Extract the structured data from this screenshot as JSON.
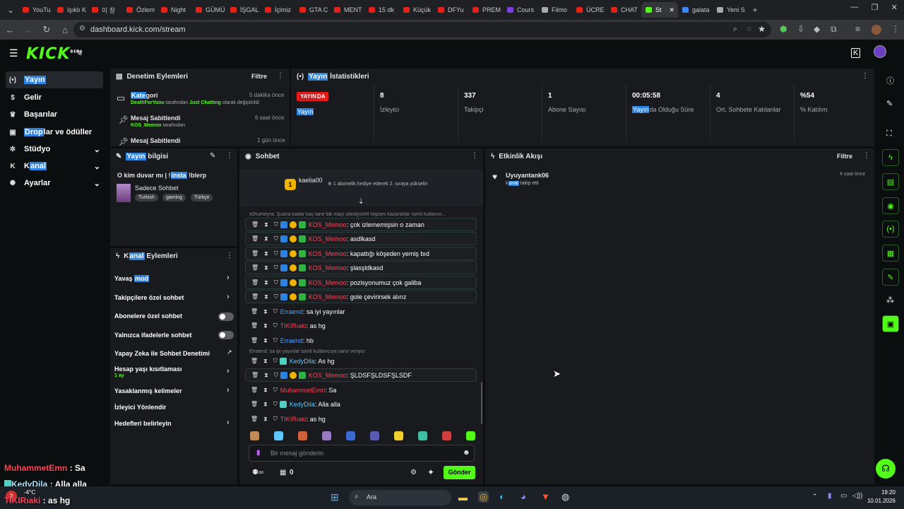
{
  "tabs": [
    {
      "label": "YouTu"
    },
    {
      "label": "Işıklı K"
    },
    {
      "label": "이 장"
    },
    {
      "label": "Özlem"
    },
    {
      "label": "Night"
    },
    {
      "label": "GÜMÜ"
    },
    {
      "label": "İŞGAL"
    },
    {
      "label": "İçimiz"
    },
    {
      "label": "GTA C"
    },
    {
      "label": "MENT"
    },
    {
      "label": "15 dk"
    },
    {
      "label": "Küçük"
    },
    {
      "label": "DFYu"
    },
    {
      "label": "PREM"
    },
    {
      "label": "Cours"
    },
    {
      "label": "Filmo"
    },
    {
      "label": "ÜCRE"
    },
    {
      "label": "CHAT"
    },
    {
      "label": "St"
    },
    {
      "label": "galata"
    },
    {
      "label": "Yeni S"
    }
  ],
  "browser": {
    "url": "dashboard.kick.com/stream",
    "new_tab_symbol": "+"
  },
  "kick": {
    "logo": "KICK",
    "logo_sup": "BETA"
  },
  "nav": [
    {
      "label": "Yayın"
    },
    {
      "label": "Gelir"
    },
    {
      "label": "Başarılar"
    },
    {
      "label_hl": "Drop",
      "label_rest": "lar ve ödüller"
    },
    {
      "label": "Stüdyo"
    },
    {
      "label_pre": "K",
      "label_hl": "anal",
      "label": "Kanal"
    },
    {
      "label": "Ayarlar"
    }
  ],
  "moderation": {
    "title": "Denetim Eylemleri",
    "filter": "Filtre",
    "items": [
      {
        "title_hl": "Kate",
        "title_rest": "gori",
        "time": "5 dakika önce",
        "user": "DeathForYoou",
        "mid": " tarafından ",
        "cat": "Just Chatting",
        "tail": " olarak değiştirildi"
      },
      {
        "title": "Mesaj Sabitlendi",
        "time": "6 saat önce",
        "user": "KOS_Memoo",
        "tail": " tarafından"
      },
      {
        "title": "Mesaj Sabitlendi",
        "time": "1 gün önce"
      }
    ]
  },
  "stats": {
    "title_hl": "Yayın",
    "title_rest": " İstatistikleri",
    "live_badge_hl": "YAYIN",
    "live_badge_rest": "DA",
    "live_label": "Yayın",
    "items": [
      {
        "value": "8",
        "label": "İzleyici"
      },
      {
        "value": "337",
        "label": "Takipçi"
      },
      {
        "value": "1",
        "label": "Abone Sayısı"
      },
      {
        "value": "00:05:58",
        "label_hl": "Yayın",
        "label_rest": "da Olduğu Süre"
      },
      {
        "value": "4",
        "label": "Ort. Sohbete Katılanlar"
      },
      {
        "value": "%54",
        "label": "% Katılım"
      }
    ]
  },
  "streaminfo": {
    "title_hl": "Yayın",
    "title_rest": " bilgisi",
    "stream_title_pre": "O kim duvar mı | !",
    "stream_title_hl": "insta",
    "stream_title_rest": " !blerp",
    "category": "Sadece Sohbet",
    "tags": [
      "Turkish",
      "gaming",
      "Türkçe"
    ]
  },
  "channel_actions": {
    "title_pre": "K",
    "title_hl": "anal",
    "title_rest": " Eylemleri",
    "items": [
      {
        "label": "Yavaş ",
        "label_hl": "mod"
      },
      {
        "label": "Takipçilere özel sohbet"
      },
      {
        "label": "Abonelere özel sohbet"
      },
      {
        "label": "Yalnızca ifadelerle sohbet"
      },
      {
        "label": "Yapay Zeka ile Sohbet Denetimi"
      },
      {
        "label": "Hesap yaşı kısıtlaması",
        "sub": "1 ay"
      },
      {
        "label": "Yasaklanmış kelimeler"
      },
      {
        "label": "İzleyici Yönlendir"
      },
      {
        "label": "Hedefleri belirleyin"
      }
    ]
  },
  "chat": {
    "title": "Sohbet",
    "pinned_user": "kaelia00",
    "pinned_badge": "1",
    "pinned_text": "1 abonelik hediye ederek 2. sıraya yükselin",
    "reply1": "x0humeyra: Şuana kadar kaç tane bik maçı izlediyseM hepsini kazandılar isimli kullanıcı...",
    "reply2": "Erraend: sa iyi yayınlar isimli kullanıcıya yanıt veriyor",
    "messages": [
      {
        "user": "KOS_Memoo",
        "text": ": çok izlememişsin o zaman"
      },
      {
        "user": "KOS_Memoo",
        "text": ": asdlkasd"
      },
      {
        "user": "KOS_Memoo",
        "text": ": kapattığı köşeden yemiş bıd"
      },
      {
        "user": "KOS_Memoo",
        "text": ": şlasşldkasd"
      },
      {
        "user": "KOS_Memoo",
        "text": ": pozisyonumuz çok galiba"
      },
      {
        "user": "KOS_Memoo",
        "text": ": gole çevirirsek alırız"
      },
      {
        "user": "Erraend",
        "text": ": sa iyi yayınlar"
      },
      {
        "user": "TIKIRıaki",
        "text": ": as hg"
      },
      {
        "user": "Erraend",
        "text": ": hb"
      },
      {
        "user": "KedyDila",
        "text": ": As hg"
      },
      {
        "user": "KOS_Memoo",
        "text": ": ŞLDSFŞLDSFŞLSDF"
      },
      {
        "user": "MuhammetEmn",
        "text": ": Sa"
      },
      {
        "user": "KedyDila",
        "text": ": Alla alla"
      },
      {
        "user": "TIKIRıaki",
        "text": ": as hg"
      }
    ],
    "placeholder": "Bir mesaj gönderin",
    "send": "Gönder",
    "count": "0"
  },
  "activity": {
    "title": "Etkinlik Akışı",
    "filter": "Filtre",
    "items": [
      {
        "user": "Uyuyantank06",
        "text_pre": "k",
        "text_hl": "anal",
        "text_rest": " takip etti",
        "time": "4 saat önce"
      }
    ]
  },
  "overlay": [
    {
      "user": "MuhammetEmn",
      "text": " : Sa"
    },
    {
      "user": "KedyDila",
      "text": " : Alla alla"
    },
    {
      "user": "TIKIRıaki",
      "text": " : as hg"
    }
  ],
  "taskbar": {
    "search": "Ara",
    "weather": "-4°C",
    "weather_badge": "2",
    "time": "19:20",
    "date": "10.01.2026"
  },
  "colors": {
    "accent": "#53fc18",
    "red_user": "#ff4258",
    "blue_user": "#4fa0ff",
    "highlight": "#2c82e0",
    "live": "#e91916"
  }
}
